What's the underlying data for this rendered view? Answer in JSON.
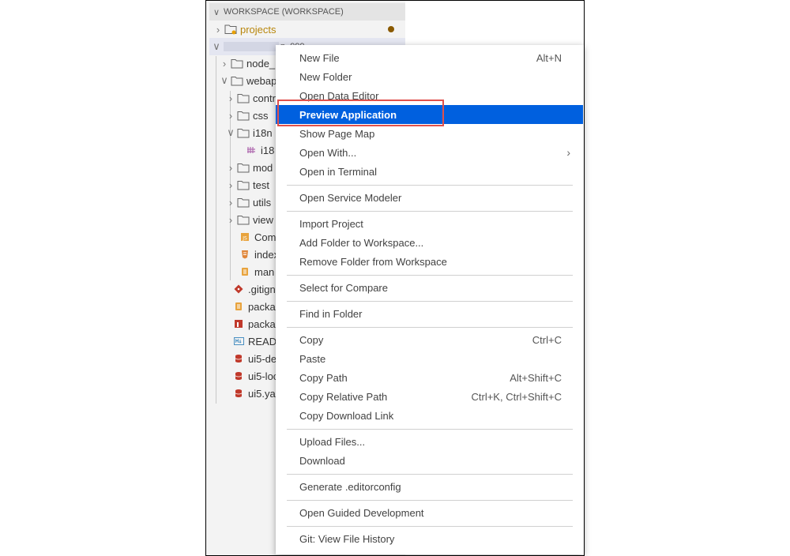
{
  "explorer": {
    "workspace_title": "WORKSPACE (WORKSPACE)",
    "items": [
      {
        "label": "projects",
        "icon": "folder-icon"
      },
      {
        "label": "node_",
        "icon": "folder-icon"
      },
      {
        "label": "webap",
        "icon": "folder-icon"
      },
      {
        "label": "contr",
        "icon": "folder-icon"
      },
      {
        "label": "css",
        "icon": "folder-icon"
      },
      {
        "label": "i18n",
        "icon": "folder-icon"
      },
      {
        "label": "i18",
        "icon": "properties-file-icon"
      },
      {
        "label": "mod",
        "icon": "folder-icon"
      },
      {
        "label": "test",
        "icon": "folder-icon"
      },
      {
        "label": "utils",
        "icon": "folder-icon"
      },
      {
        "label": "view",
        "icon": "folder-icon"
      },
      {
        "label": "Com",
        "icon": "js-file-icon"
      },
      {
        "label": "index",
        "icon": "html-file-icon"
      },
      {
        "label": "man",
        "icon": "json-file-icon"
      },
      {
        "label": ".gitign",
        "icon": "git-icon"
      },
      {
        "label": "packa",
        "icon": "json-file-icon"
      },
      {
        "label": "packa",
        "icon": "npm-file-icon"
      },
      {
        "label": "READ",
        "icon": "markdown-file-icon"
      },
      {
        "label": "ui5-de",
        "icon": "yaml-file-icon"
      },
      {
        "label": "ui5-loc",
        "icon": "yaml-file-icon"
      },
      {
        "label": "ui5.ya",
        "icon": "yaml-file-icon"
      }
    ],
    "root_label_fragment": "p_999"
  },
  "context_menu": {
    "items": [
      {
        "label": "New File",
        "shortcut": "Alt+N"
      },
      {
        "label": "New Folder",
        "shortcut": ""
      },
      {
        "label": "Open Data Editor",
        "shortcut": ""
      },
      {
        "label": "Preview Application",
        "shortcut": ""
      },
      {
        "label": "Show Page Map",
        "shortcut": ""
      },
      {
        "label": "Open With...",
        "shortcut": ""
      },
      {
        "label": "Open in Terminal",
        "shortcut": ""
      },
      {
        "label": "Open Service Modeler",
        "shortcut": ""
      },
      {
        "label": "Import Project",
        "shortcut": ""
      },
      {
        "label": "Add Folder to Workspace...",
        "shortcut": ""
      },
      {
        "label": "Remove Folder from Workspace",
        "shortcut": ""
      },
      {
        "label": "Select for Compare",
        "shortcut": ""
      },
      {
        "label": "Find in Folder",
        "shortcut": ""
      },
      {
        "label": "Copy",
        "shortcut": "Ctrl+C"
      },
      {
        "label": "Paste",
        "shortcut": ""
      },
      {
        "label": "Copy Path",
        "shortcut": "Alt+Shift+C"
      },
      {
        "label": "Copy Relative Path",
        "shortcut": "Ctrl+K, Ctrl+Shift+C"
      },
      {
        "label": "Copy Download Link",
        "shortcut": ""
      },
      {
        "label": "Upload Files...",
        "shortcut": ""
      },
      {
        "label": "Download",
        "shortcut": ""
      },
      {
        "label": "Generate .editorconfig",
        "shortcut": ""
      },
      {
        "label": "Open Guided Development",
        "shortcut": ""
      },
      {
        "label": "Git: View File History",
        "shortcut": ""
      }
    ],
    "selected_label": "Preview Application"
  },
  "colors": {
    "selection": "#0060df",
    "callout": "#e0514c",
    "modified_dot": "#8a5a00"
  }
}
